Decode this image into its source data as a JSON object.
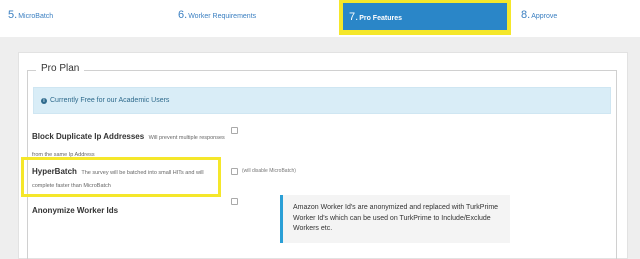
{
  "steps": {
    "step5": {
      "num": "5.",
      "label": "MicroBatch"
    },
    "step6": {
      "num": "6.",
      "label": "Worker Requirements"
    },
    "step7": {
      "num": "7.",
      "label": "Pro Features"
    },
    "step8": {
      "num": "8.",
      "label": "Approve"
    }
  },
  "pro_plan": {
    "legend": "Pro Plan",
    "alert_icon": "info-icon",
    "alert_text": "Currently Free for our Academic Users",
    "options": [
      {
        "label": "Block Duplicate Ip Addresses",
        "help": "Will prevent multiple responses from the same Ip Address",
        "checked": false
      },
      {
        "label": "HyperBatch",
        "help": "The survey will be batched into small HITs and will complete faster than MicroBatch",
        "note": "(will disable MicroBatch)",
        "checked": false
      },
      {
        "label": "Anonymize Worker Ids",
        "checked": false
      }
    ],
    "callout_text": "Amazon Worker Id's are anonymized and replaced with TurkPrime Worker Id's which can be used on TurkPrime to Include/Exclude Workers etc."
  },
  "colors": {
    "active_step": "#2a86c8",
    "highlight": "#f5e72a",
    "link": "#3a7fc1",
    "alert_bg": "#d9edf7",
    "callout_border": "#2a9fd6"
  }
}
